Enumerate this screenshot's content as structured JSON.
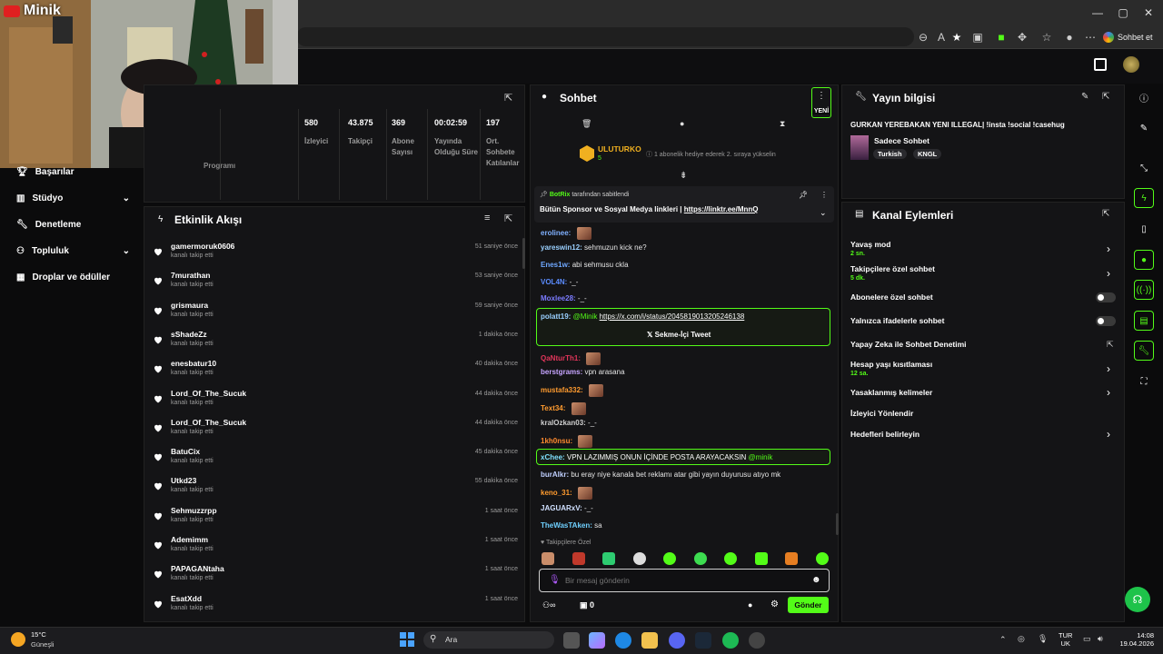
{
  "browser": {
    "sohbet_et": "Sohbet et",
    "search_icon": "search-icon"
  },
  "webcam": {
    "channel_name": "Minik"
  },
  "stats": [
    {
      "value": "580",
      "label": "İzleyici"
    },
    {
      "value": "43.875",
      "label": "Takipçi"
    },
    {
      "value": "369",
      "label": "Abone Sayısı"
    },
    {
      "value": "00:02:59",
      "label": "Yayında Olduğu Süre"
    },
    {
      "value": "197",
      "label": "Ort. Sohbete Katılanlar"
    }
  ],
  "stats_partial_label": "Programı",
  "nav": {
    "items": [
      {
        "label": "Başarılar",
        "icon": "trophy-icon"
      },
      {
        "label": "Stüdyo",
        "icon": "studio-icon",
        "chevron": true
      },
      {
        "label": "Denetleme",
        "icon": "wrench-icon"
      },
      {
        "label": "Topluluk",
        "icon": "people-icon",
        "chevron": true
      },
      {
        "label": "Droplar ve ödüller",
        "icon": "gift-icon"
      }
    ]
  },
  "activity": {
    "title": "Etkinlik Akışı",
    "items": [
      {
        "user": "gamermoruk0606",
        "action": "kanalı takip etti",
        "time": "51 saniye önce"
      },
      {
        "user": "7murathan",
        "action": "kanalı takip etti",
        "time": "53 saniye önce"
      },
      {
        "user": "grismaura",
        "action": "kanalı takip etti",
        "time": "59 saniye önce"
      },
      {
        "user": "sShadeZz",
        "action": "kanalı takip etti",
        "time": "1 dakika önce"
      },
      {
        "user": "enesbatur10",
        "action": "kanalı takip etti",
        "time": "40 dakika önce"
      },
      {
        "user": "Lord_Of_The_Sucuk",
        "action": "kanalı takip etti",
        "time": "44 dakika önce"
      },
      {
        "user": "Lord_Of_The_Sucuk",
        "action": "kanalı takip etti",
        "time": "44 dakika önce"
      },
      {
        "user": "BatuCix",
        "action": "kanalı takip etti",
        "time": "45 dakika önce"
      },
      {
        "user": "Utkd23",
        "action": "kanalı takip etti",
        "time": "55 dakika önce"
      },
      {
        "user": "Sehmuzzrpp",
        "action": "kanalı takip etti",
        "time": "1 saat önce"
      },
      {
        "user": "Ademimm",
        "action": "kanalı takip etti",
        "time": "1 saat önce"
      },
      {
        "user": "PAPAGANtaha",
        "action": "kanalı takip etti",
        "time": "1 saat önce"
      },
      {
        "user": "EsatXdd",
        "action": "kanalı takip etti",
        "time": "1 saat önce"
      }
    ]
  },
  "chat": {
    "title": "Sohbet",
    "new_badge": "YENİ",
    "gifter": {
      "name": "ULUTURKO",
      "count": "5",
      "note": "1 abonelik hediye ederek 2. sıraya yükselin"
    },
    "pinned": {
      "by": "BotRix",
      "by_suffix": "tarafından sabitlendi",
      "text": "Bütün Sponsor ve Sosyal Medya linkleri |",
      "link": "https://linktr.ee/MnnQ"
    },
    "messages": [
      {
        "user": "erolinee:",
        "color": "#7fb0ff",
        "text": "",
        "emote": true
      },
      {
        "user": "yareswin12:",
        "color": "#9ad0ff",
        "text": "sehmuzun kick ne?"
      },
      {
        "user": "Enes1w:",
        "color": "#6fa8ff",
        "text": "abi sehmusu ckla"
      },
      {
        "user": "VOL4N:",
        "color": "#5b8cff",
        "text": "-_-"
      },
      {
        "user": "Moxlee28:",
        "color": "#7b7bff",
        "text": "-_-"
      },
      {
        "user": "QaNturTh1:",
        "color": "#e0355a",
        "text": "",
        "emote": true
      },
      {
        "user": "berstgrams:",
        "color": "#c6a4ff",
        "text": "vpn arasana"
      },
      {
        "user": "mustafa332:",
        "color": "#ff9b2f",
        "text": "",
        "emote": true
      },
      {
        "user": "Text34:",
        "color": "#ff9b2f",
        "text": "",
        "emote": true
      },
      {
        "user": "kralOzkan03:",
        "color": "#d0d0d0",
        "text": "-_-"
      },
      {
        "user": "1kh0nsu:",
        "color": "#ff8a2f",
        "text": "",
        "emote": true
      },
      {
        "user": "burAlkr:",
        "color": "#c0d0ff",
        "text": "bu eray niye kanala bet reklamı atar gibi yayın duyurusu atıyo mk"
      },
      {
        "user": "keno_31:",
        "color": "#ff9b2f",
        "text": "",
        "emote": true
      },
      {
        "user": "JAGUARxV:",
        "color": "#d0e0ff",
        "text": "-_-"
      },
      {
        "user": "TheWasTAken:",
        "color": "#6fd0ff",
        "text": "sa"
      }
    ],
    "highlight1": {
      "user": "polatt19:",
      "mention": "@Minik",
      "link": "https://x.com/i/status/2045819013205246138",
      "tweet_button": "Sekme-İçi Tweet"
    },
    "highlight2": {
      "user": "xChee:",
      "text": "VPN LAZIMMIŞ ONUN İÇİNDE POSTA ARAYACAKSIN",
      "mention": "@minik"
    },
    "followers_only": "Takipçilere Özel",
    "input_placeholder": "Bir mesaj gönderin",
    "viewer_count": "0",
    "send_label": "Gönder"
  },
  "stream_info": {
    "title": "Yayın bilgisi",
    "stream_title": "GURKAN YEREBAKAN YENI ILLEGAL| !insta !social !casehug",
    "category": "Sadece Sohbet",
    "tags": [
      "Turkish",
      "KNGL"
    ]
  },
  "channel_actions": {
    "title": "Kanal Eylemleri",
    "rows": [
      {
        "label": "Yavaş mod",
        "sub": "2 sn.",
        "control": "chevron"
      },
      {
        "label": "Takipçilere özel sohbet",
        "sub": "5 dk.",
        "control": "chevron"
      },
      {
        "label": "Abonelere özel sohbet",
        "sub": "",
        "control": "toggle"
      },
      {
        "label": "Yalnızca ifadelerle sohbet",
        "sub": "",
        "control": "toggle"
      },
      {
        "label": "Yapay Zeka ile Sohbet Denetimi",
        "sub": "",
        "control": "external"
      },
      {
        "label": "Hesap yaşı kısıtlaması",
        "sub": "12 sa.",
        "control": "chevron"
      },
      {
        "label": "Yasaklanmış kelimeler",
        "sub": "",
        "control": "chevron"
      },
      {
        "label": "İzleyici Yönlendir",
        "sub": "",
        "control": "none"
      },
      {
        "label": "Hedefleri belirleyin",
        "sub": "",
        "control": "chevron"
      }
    ]
  },
  "taskbar": {
    "weather_temp": "15°C",
    "weather_desc": "Güneşli",
    "search": "Ara",
    "lang1": "TUR",
    "lang2": "UK",
    "time": "14:08",
    "date": "19.04.2026"
  },
  "colors": {
    "accent": "#53fc18",
    "bg": "#0b0b0c",
    "panel": "#141416"
  }
}
